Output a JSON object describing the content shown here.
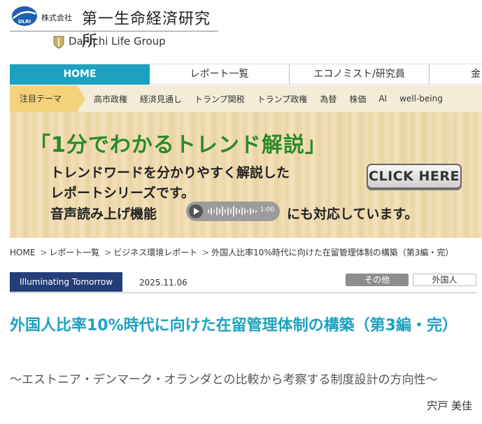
{
  "header": {
    "logo_mark_text": "DLRI",
    "logo_small": "株式会社",
    "logo_big": "第一生命経済研究所",
    "group_text": "Dai-ichi Life Group"
  },
  "nav": {
    "items": [
      {
        "label": "HOME",
        "active": true
      },
      {
        "label": "レポート一覧",
        "active": false
      },
      {
        "label": "エコノミスト/研究員",
        "active": false
      },
      {
        "label": "金",
        "active": false
      }
    ]
  },
  "topics": {
    "label": "注目テーマ",
    "items": [
      "高市政権",
      "経済見通し",
      "トランプ関税",
      "トランプ政権",
      "為替",
      "株価",
      "AI",
      "well-being"
    ]
  },
  "banner": {
    "title": "「1分でわかるトレンド解説」",
    "line1": "トレンドワードを分かりやすく解説した",
    "line2": "レポートシリーズです。",
    "line3_pre": "音声読み上げ機能",
    "line3_post": "にも対応しています。",
    "audio_time": "1:00",
    "button": "CLICK HERE"
  },
  "breadcrumb": {
    "items": [
      "HOME",
      "レポート一覧",
      "ビジネス環境レポート",
      "外国人比率10%時代に向けた在留管理体制の構築（第3編・完）"
    ]
  },
  "meta": {
    "series": "Illuminating Tomorrow",
    "date": "2025.11.06",
    "category": "その他",
    "tag": "外国人"
  },
  "article": {
    "title": "外国人比率10%時代に向けた在留管理体制の構築（第3編・完）",
    "subtitle": "～エストニア・デンマーク・オランダとの比較から考察する制度設計の方向性～",
    "author": "宍戸 美佳"
  },
  "colors": {
    "accent": "#1ca2c0",
    "navy": "#243e7a",
    "banner_green": "#2b8a2a"
  }
}
